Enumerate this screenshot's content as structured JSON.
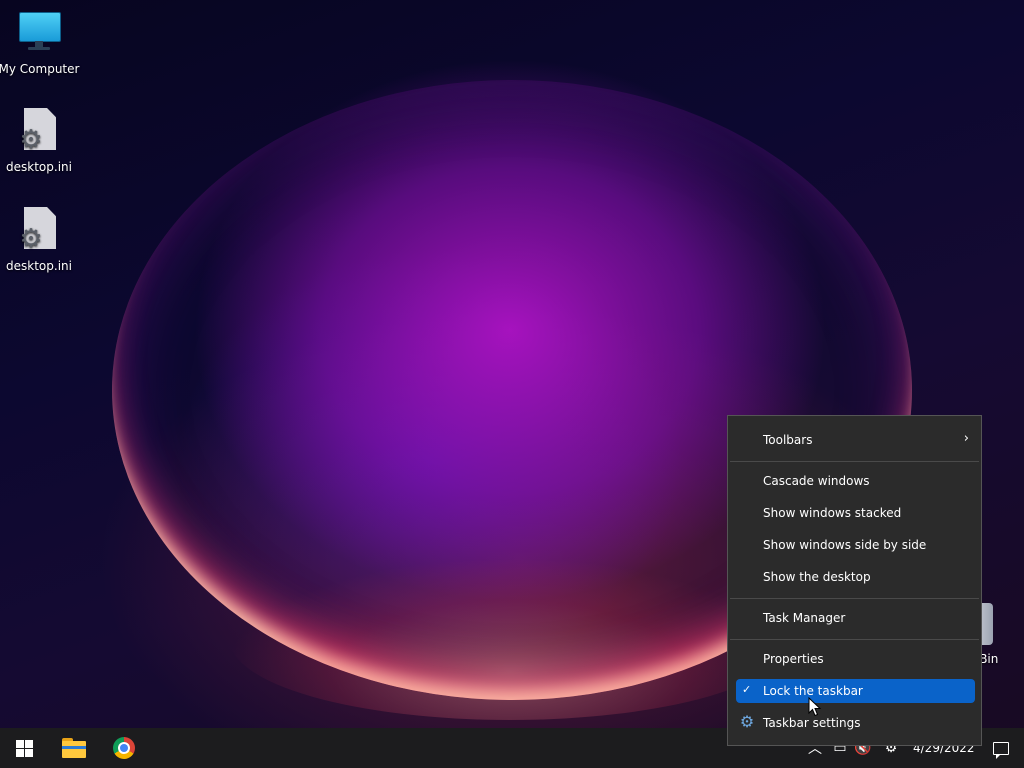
{
  "desktop": {
    "icons": [
      {
        "label": "My Computer",
        "icon": "monitor-icon"
      },
      {
        "label": "desktop.ini",
        "icon": "ini-file-icon"
      },
      {
        "label": "desktop.ini",
        "icon": "ini-file-icon"
      }
    ],
    "partial_icon_label": "e Bin"
  },
  "context_menu": {
    "items": {
      "toolbars": "Toolbars",
      "cascade": "Cascade windows",
      "stacked": "Show windows stacked",
      "side_by_side": "Show windows side by side",
      "show_desktop": "Show the desktop",
      "task_manager": "Task Manager",
      "properties": "Properties",
      "lock_taskbar": "Lock the taskbar",
      "taskbar_settings": "Taskbar settings"
    },
    "lock_taskbar_checked": true,
    "highlight_color": "#0a63c9"
  },
  "taskbar": {
    "pinned": [
      "start-icon",
      "file-explorer-icon",
      "chrome-icon"
    ],
    "date": "4/29/2022"
  }
}
